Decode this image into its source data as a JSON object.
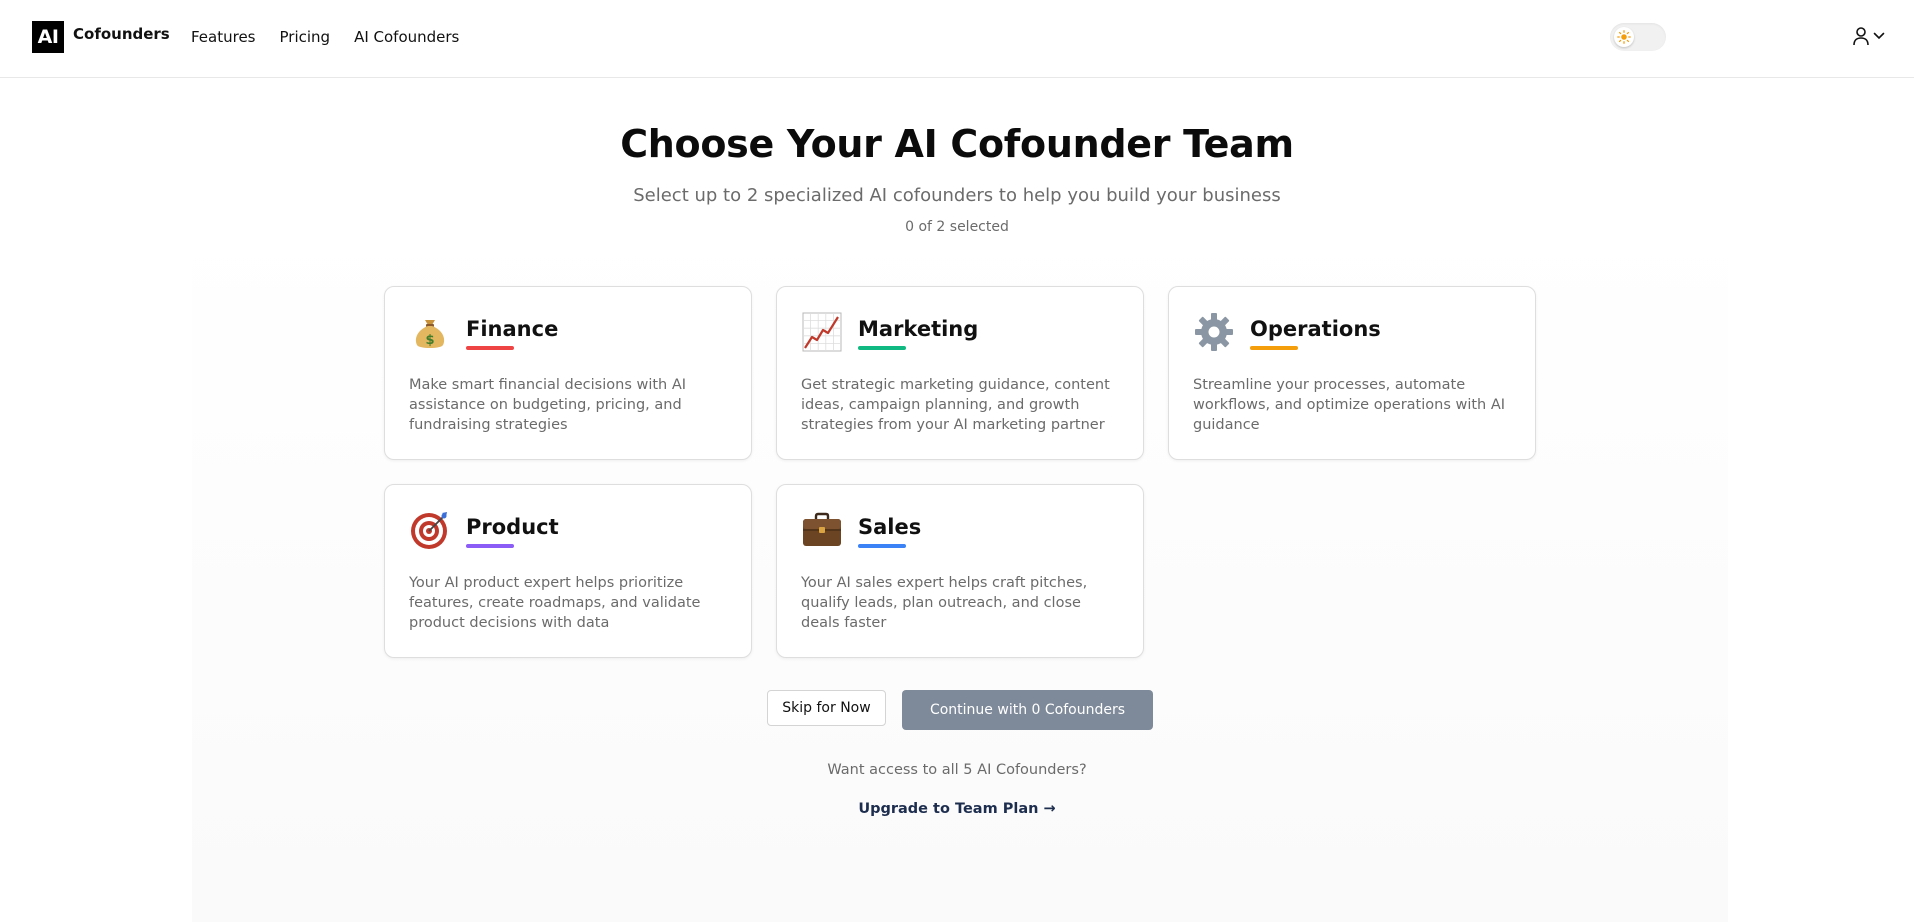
{
  "header": {
    "logo_mark": "AI",
    "logo_text": "Cofounders",
    "nav": [
      "Features",
      "Pricing",
      "AI Cofounders"
    ],
    "theme_toggle_icon": "sun-icon",
    "user_icon": "user-icon"
  },
  "hero": {
    "title": "Choose Your AI Cofounder Team",
    "subtitle": "Select up to 2 specialized AI cofounders to help you build your business",
    "counter": "0 of 2 selected"
  },
  "cofounders": [
    {
      "title": "Finance",
      "icon": "money-bag-icon",
      "accent": "#ef4444",
      "description": "Make smart financial decisions with AI assistance on budgeting, pricing, and fundraising strategies"
    },
    {
      "title": "Marketing",
      "icon": "chart-up-icon",
      "accent": "#10b981",
      "description": "Get strategic marketing guidance, content ideas, campaign planning, and growth strategies from your AI marketing partner"
    },
    {
      "title": "Operations",
      "icon": "gear-icon",
      "accent": "#f59e0b",
      "description": "Streamline your processes, automate workflows, and optimize operations with AI guidance"
    },
    {
      "title": "Product",
      "icon": "target-icon",
      "accent": "#8b5cf6",
      "description": "Your AI product expert helps prioritize features, create roadmaps, and validate product decisions with data"
    },
    {
      "title": "Sales",
      "icon": "briefcase-icon",
      "accent": "#3b82f6",
      "description": "Your AI sales expert helps craft pitches, qualify leads, plan outreach, and close deals faster"
    }
  ],
  "actions": {
    "skip_label": "Skip for Now",
    "continue_label": "Continue with 0 Cofounders",
    "continue_color": "#7e8a99"
  },
  "footer": {
    "access_text": "Want access to all 5 AI Cofounders?",
    "upgrade_label": "Upgrade to Team Plan →"
  }
}
